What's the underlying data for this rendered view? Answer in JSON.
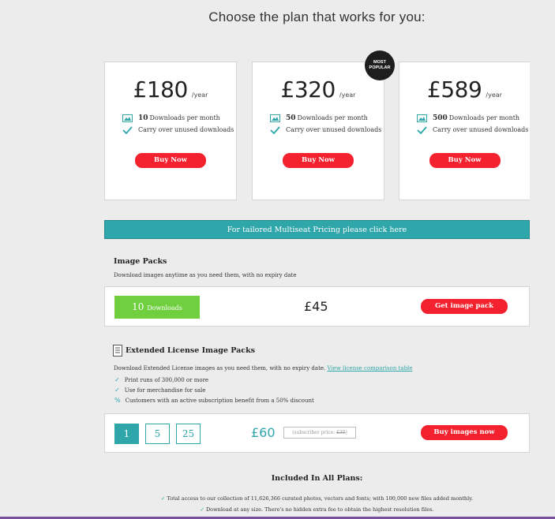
{
  "headline": "Choose the plan that works for you:",
  "badge": {
    "line1": "MOST",
    "line2": "POPULAR"
  },
  "plans": [
    {
      "price": "£180",
      "period": "/year",
      "downloads_count": "10",
      "downloads_label": "Downloads per month",
      "carry_over": "Carry over unused downloads",
      "button": "Buy Now"
    },
    {
      "price": "£320",
      "period": "/year",
      "downloads_count": "50",
      "downloads_label": "Downloads per month",
      "carry_over": "Carry over unused downloads",
      "button": "Buy Now"
    },
    {
      "price": "£589",
      "period": "/year",
      "downloads_count": "500",
      "downloads_label": "Downloads per month",
      "carry_over": "Carry over unused downloads",
      "button": "Buy Now"
    }
  ],
  "multiseat": "For tailored Multiseat Pricing please click here",
  "image_packs": {
    "title": "Image Packs",
    "subtitle": "Download images anytime as you need them, with no expiry date",
    "count": "10",
    "count_label": "Downloads",
    "price": "£45",
    "button": "Get image pack"
  },
  "extended": {
    "title": "Extended License Image Packs",
    "description": "Download Extended License images as you need them, with no expiry date.",
    "link": "View license comparison table",
    "points": [
      "Print runs of 300,000 or more",
      "Use for merchandise for sale"
    ],
    "discount": "Customers with an active subscription benefit from a 50% discount",
    "quantities": [
      "1",
      "5",
      "25"
    ],
    "price": "£60",
    "subscriber_label": "(subscriber price:",
    "subscriber_price": "£30",
    "subscriber_close": ")",
    "button": "Buy images now"
  },
  "included": {
    "title": "Included In All Plans:",
    "items": [
      "Total access to our collection of 11,626,366 curated photos, vectors and fonts; with 100,000 new files added monthly.",
      "Download at any size. There's no hidden extra fee to obtain the highest resolution files."
    ]
  },
  "colors": {
    "accent": "#2ea6aa",
    "cta": "#f4212e",
    "green": "#6fcf3e",
    "badge": "#1e1e1e"
  }
}
